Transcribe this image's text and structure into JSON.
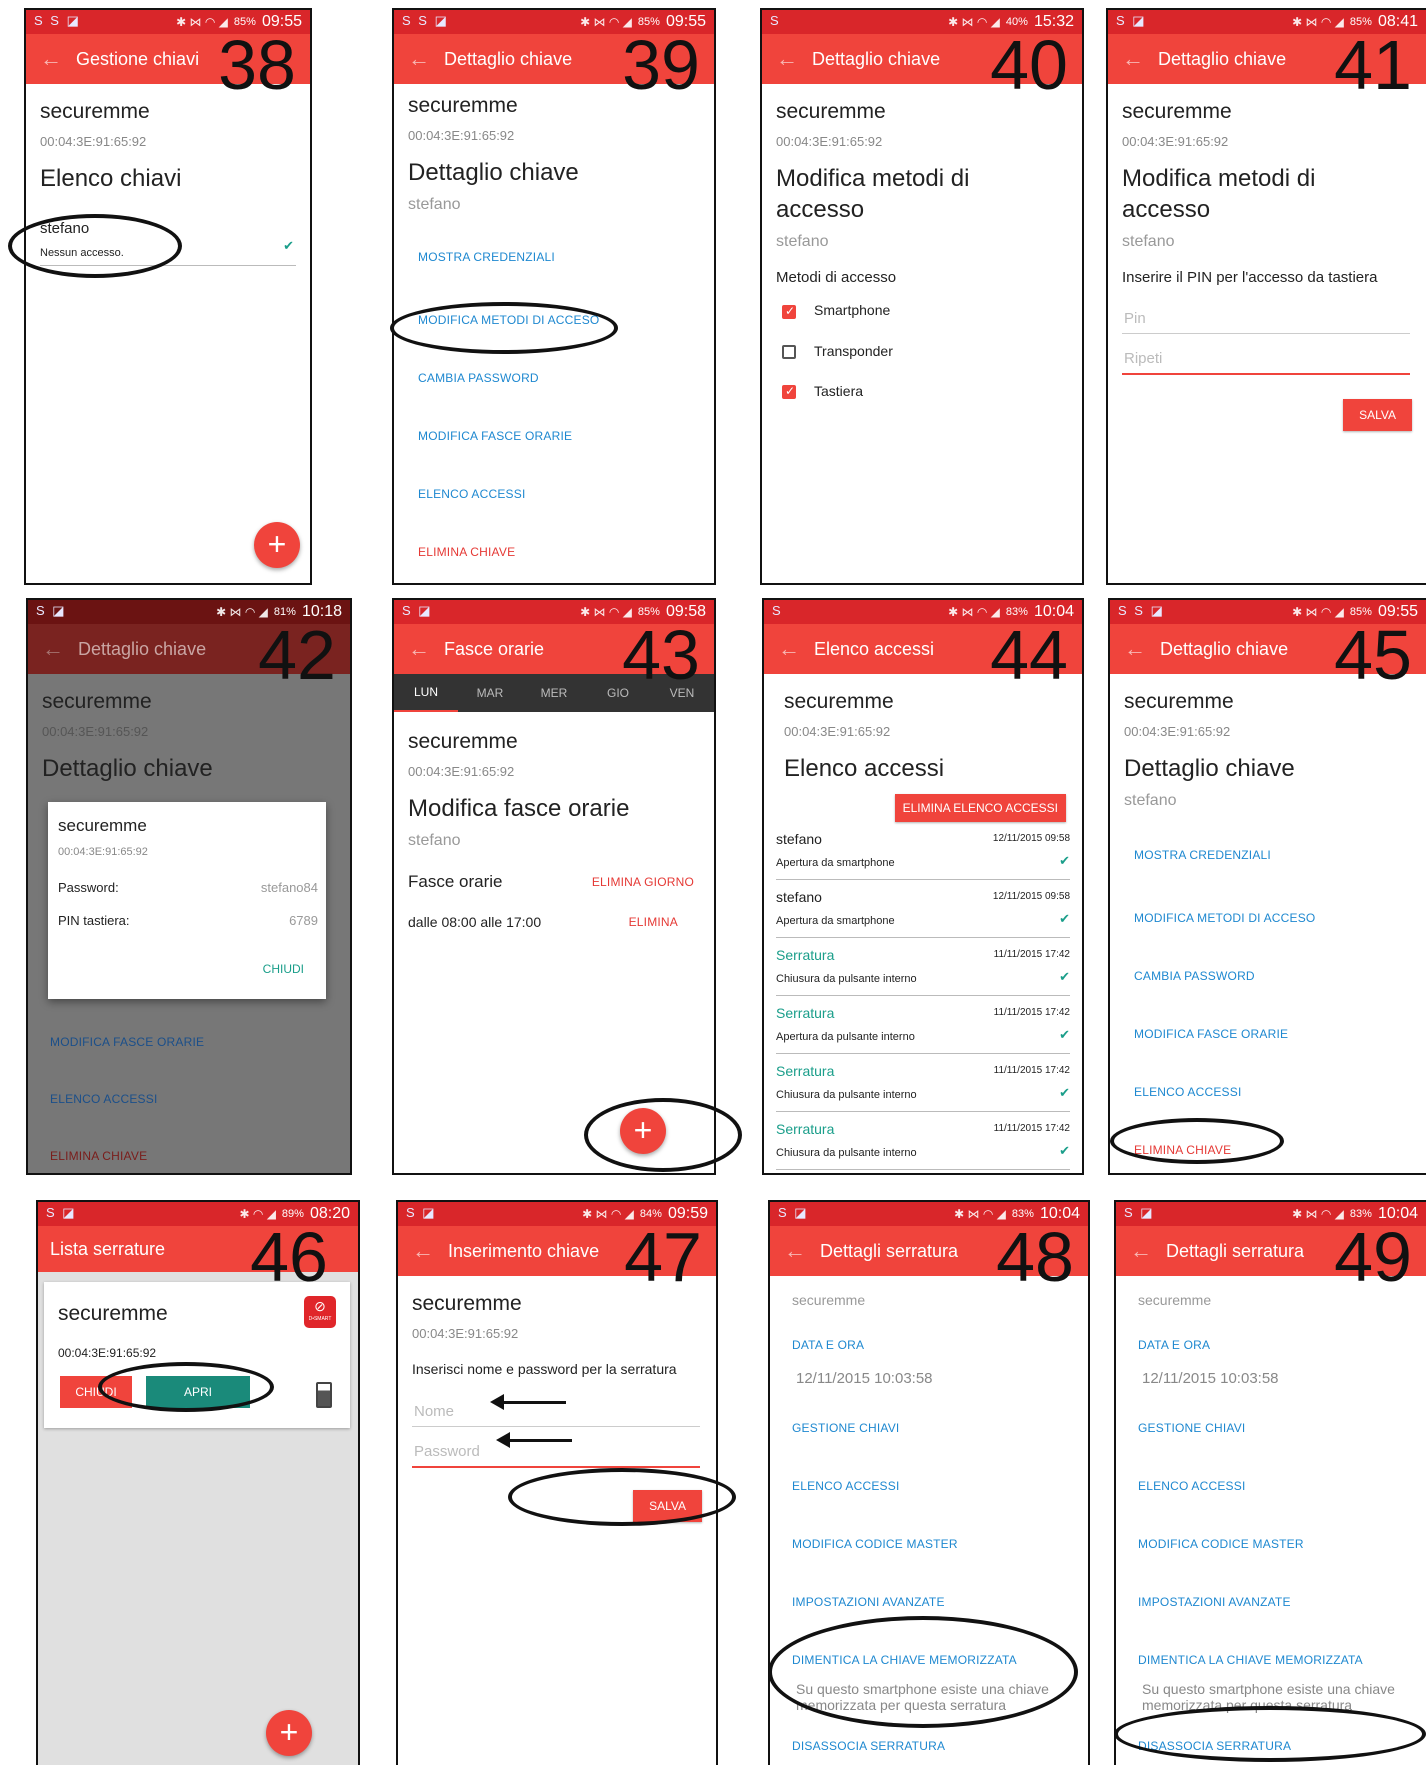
{
  "common": {
    "device": "securemme",
    "mac": "00:04:3E:91:65:92",
    "key_user": "stefano"
  },
  "screens": {
    "s38": {
      "num": "38",
      "time": "09:55",
      "batt": "85%",
      "title": "Gestione chiavi",
      "heading": "Elenco chiavi",
      "item_name": "stefano",
      "item_status": "Nessun accesso."
    },
    "s39": {
      "num": "39",
      "time": "09:55",
      "batt": "85%",
      "title": "Dettaglio chiave",
      "heading": "Dettaglio chiave",
      "links": [
        "MOSTRA CREDENZIALI",
        "MODIFICA METODI DI ACCESO",
        "CAMBIA PASSWORD",
        "MODIFICA FASCE ORARIE",
        "ELENCO ACCESSI"
      ],
      "delete": "ELIMINA CHIAVE"
    },
    "s40": {
      "num": "40",
      "time": "15:32",
      "batt": "40%",
      "title": "Dettaglio chiave",
      "heading": "Modifica metodi di accesso",
      "section": "Metodi di accesso",
      "opt1": "Smartphone",
      "opt2": "Transponder",
      "opt3": "Tastiera"
    },
    "s41": {
      "num": "41",
      "time": "08:41",
      "batt": "85%",
      "title": "Dettaglio chiave",
      "heading": "Modifica metodi di accesso",
      "prompt": "Inserire il PIN per l'accesso da tastiera",
      "pin_ph": "Pin",
      "repeat_ph": "Ripeti",
      "save": "SALVA"
    },
    "s42": {
      "num": "42",
      "time": "10:18",
      "batt": "81%",
      "title": "Dettaglio chiave",
      "heading": "Dettaglio chiave",
      "dialog": {
        "title": "securemme",
        "mac": "00:04:3E:91:65:92",
        "pw_label": "Password:",
        "pw_value": "stefano84",
        "pin_label": "PIN tastiera:",
        "pin_value": "6789",
        "close": "CHIUDI"
      },
      "links": [
        "MODIFICA FASCE ORARIE",
        "ELENCO ACCESSI"
      ],
      "delete": "ELIMINA CHIAVE"
    },
    "s43": {
      "num": "43",
      "time": "09:58",
      "batt": "85%",
      "title": "Fasce orarie",
      "tabs": [
        "LUN",
        "MAR",
        "MER",
        "GIO",
        "VEN"
      ],
      "heading": "Modifica fasce orarie",
      "section": "Fasce orarie",
      "delete_day": "ELIMINA GIORNO",
      "slot": "dalle 08:00 alle 17:00",
      "delete": "ELIMINA"
    },
    "s44": {
      "num": "44",
      "time": "10:04",
      "batt": "83%",
      "title": "Elenco accessi",
      "heading": "Elenco accessi",
      "clear": "ELIMINA ELENCO ACCESSI",
      "rows": [
        {
          "who": "stefano",
          "when": "12/11/2015 09:58",
          "what": "Apertura da smartphone"
        },
        {
          "who": "stefano",
          "when": "12/11/2015 09:58",
          "what": "Apertura da smartphone"
        },
        {
          "who": "Serratura",
          "when": "11/11/2015 17:42",
          "what": "Chiusura da pulsante interno"
        },
        {
          "who": "Serratura",
          "when": "11/11/2015 17:42",
          "what": "Apertura da pulsante interno"
        },
        {
          "who": "Serratura",
          "when": "11/11/2015 17:42",
          "what": "Chiusura da pulsante interno"
        },
        {
          "who": "Serratura",
          "when": "11/11/2015 17:42",
          "what": "Chiusura da pulsante interno"
        }
      ]
    },
    "s45": {
      "num": "45",
      "time": "09:55",
      "batt": "85%",
      "title": "Dettaglio chiave",
      "heading": "Dettaglio chiave",
      "links": [
        "MOSTRA CREDENZIALI",
        "MODIFICA METODI DI ACCESO",
        "CAMBIA PASSWORD",
        "MODIFICA FASCE ORARIE",
        "ELENCO ACCESSI"
      ],
      "delete": "ELIMINA CHIAVE"
    },
    "s46": {
      "num": "46",
      "time": "08:20",
      "batt": "89%",
      "title": "Lista serrature",
      "close": "CHIUDI",
      "open": "APRI",
      "logo": "D•SMART"
    },
    "s47": {
      "num": "47",
      "time": "09:59",
      "batt": "84%",
      "title": "Inserimento chiave",
      "prompt": "Inserisci nome e password per la serratura",
      "name_ph": "Nome",
      "pw_ph": "Password",
      "save": "SALVA"
    },
    "s48": {
      "num": "48",
      "time": "10:04",
      "batt": "83%",
      "title": "Dettagli serratura",
      "date_label": "DATA E ORA",
      "date_value": "12/11/2015 10:03:58",
      "links": [
        "GESTIONE CHIAVI",
        "ELENCO ACCESSI",
        "MODIFICA CODICE MASTER",
        "IMPOSTAZIONI AVANZATE",
        "DIMENTICA LA CHIAVE MEMORIZZATA"
      ],
      "note": "Su questo smartphone esiste una chiave memorizzata per questa serratura",
      "unlink": "DISASSOCIA SERRATURA"
    },
    "s49": {
      "num": "49",
      "time": "10:04",
      "batt": "83%",
      "title": "Dettagli serratura",
      "date_label": "DATA E ORA",
      "date_value": "12/11/2015 10:03:58",
      "links": [
        "GESTIONE CHIAVI",
        "ELENCO ACCESSI",
        "MODIFICA CODICE MASTER",
        "IMPOSTAZIONI AVANZATE",
        "DIMENTICA LA CHIAVE MEMORIZZATA"
      ],
      "note": "Su questo smartphone esiste una chiave memorizzata per questa serratura",
      "unlink": "DISASSOCIA SERRATURA"
    }
  },
  "icons": {
    "back": "back-arrow-icon",
    "add": "plus-icon",
    "check": "checkmark-icon",
    "battery": "battery-icon"
  },
  "colors": {
    "primary": "#f0443c",
    "status": "#d9262a",
    "link": "#1e88d0",
    "accent": "#1a9e8a"
  }
}
